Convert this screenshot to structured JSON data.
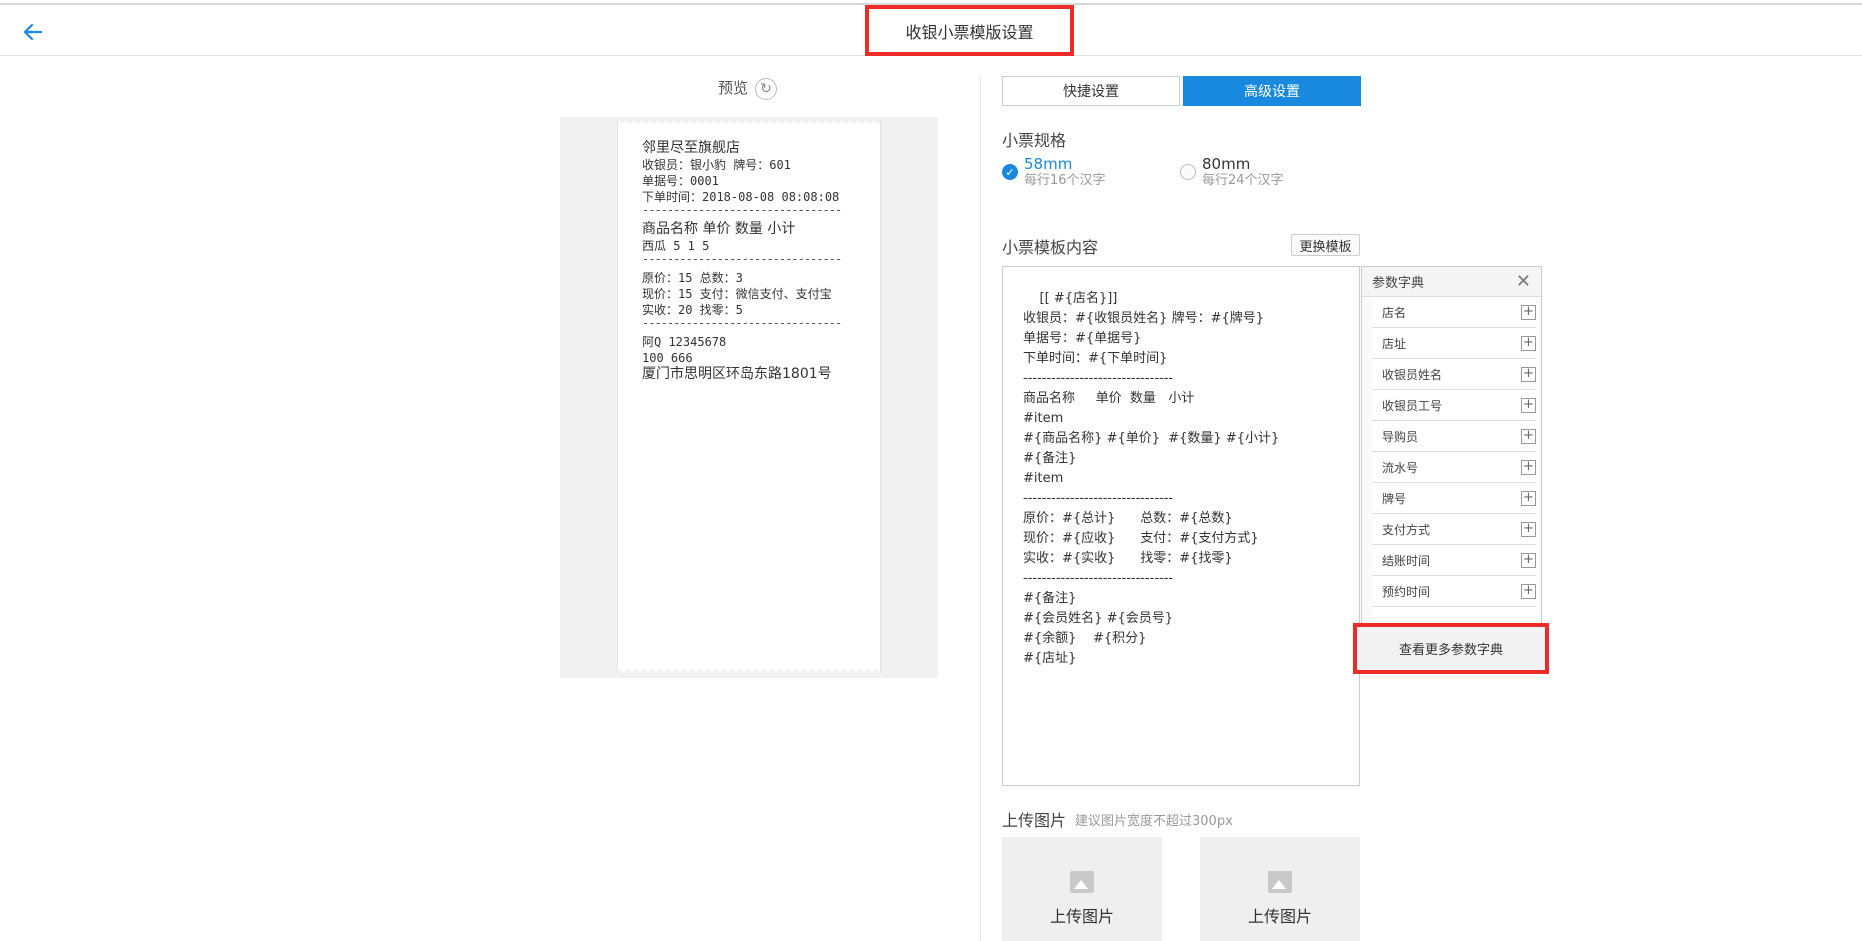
{
  "header": {
    "title": "收银小票模版设置",
    "back_icon": "arrow-left-icon"
  },
  "preview": {
    "label": "预览",
    "refresh_icon": "refresh-icon",
    "receipt_lines": [
      "邻里尽至旗舰店",
      "收银员：银小豹 牌号：601",
      "单据号：0001",
      "下单时间：2018-08-08 08:08:08",
      "--------------------------------",
      "商品名称 单价 数量 小计",
      "西瓜 5 1 5",
      "--------------------------------",
      "原价：15 总数：3",
      "现价：15 支付：微信支付、支付宝",
      "实收：20 找零：5",
      "--------------------------------",
      "阿Q 12345678",
      "100 666",
      "厦门市思明区环岛东路1801号"
    ]
  },
  "tabs": [
    {
      "label": "快捷设置",
      "active": false
    },
    {
      "label": "高级设置",
      "active": true
    }
  ],
  "spec": {
    "title": "小票规格",
    "options": [
      {
        "main": "58mm",
        "sub": "每行16个汉字",
        "selected": true
      },
      {
        "main": "80mm",
        "sub": "每行24个汉字",
        "selected": false
      }
    ]
  },
  "template": {
    "title": "小票模板内容",
    "change_button": "更换模板",
    "lines": [
      "    [[ #{店名}]]",
      "收银员：#{收银员姓名} 牌号：#{牌号}",
      "单据号：#{单据号}",
      "下单时间：#{下单时间}",
      "--------------------------------",
      "商品名称     单价  数量   小计",
      "#item",
      "#{商品名称} #{单价}  #{数量} #{小计}",
      "#{备注}",
      "#item",
      "--------------------------------",
      "原价：#{总计}      总数：#{总数}",
      "现价：#{应收}      支付：#{支付方式}",
      "实收：#{实收}      找零：#{找零}",
      "--------------------------------",
      "#{备注}",
      "#{会员姓名} #{会员号}",
      "#{余额}    #{积分}",
      "#{店址}"
    ]
  },
  "dict": {
    "title": "参数字典",
    "close_icon": "close-icon",
    "add_icon": "plus-icon",
    "items": [
      "店名",
      "店址",
      "收银员姓名",
      "收银员工号",
      "导购员",
      "流水号",
      "牌号",
      "支付方式",
      "结账时间",
      "预约时间"
    ],
    "more_button": "查看更多参数字典"
  },
  "upload": {
    "title": "上传图片",
    "hint": "建议图片宽度不超过300px",
    "boxes": [
      "上传图片",
      "上传图片"
    ],
    "image_icon": "image-icon"
  },
  "colors": {
    "accent": "#1989e0",
    "highlight": "#ee2b2b"
  }
}
